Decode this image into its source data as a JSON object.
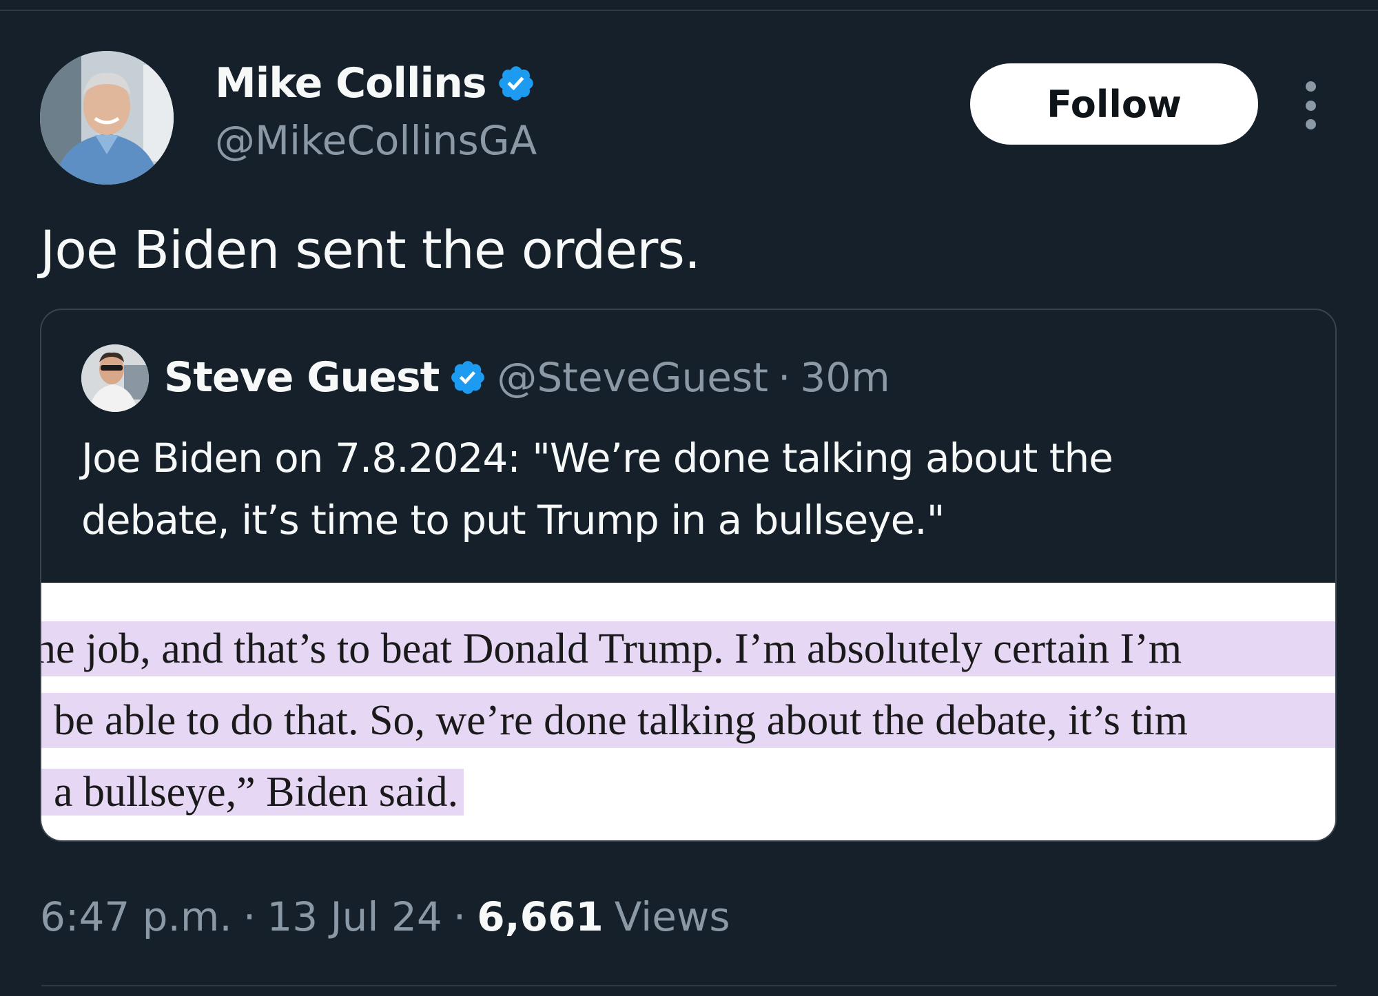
{
  "tweet": {
    "author": {
      "name": "Mike Collins",
      "handle": "@MikeCollinsGA"
    },
    "follow_label": "Follow",
    "text": "Joe Biden sent the orders.",
    "quoted": {
      "name": "Steve Guest",
      "handle": "@SteveGuest",
      "separator": "·",
      "time": "30m",
      "text_line1": "Joe Biden on 7.8.2024: \"We’re done talking about the",
      "text_line2": "debate, it’s time to put Trump in a bullseye.\"",
      "media": {
        "line1": "ne job, and that’s to beat Donald Trump. I’m absolutely certain I’m",
        "line2": "be able to do that. So, we’re done talking about the debate, it’s tim",
        "line3": "a bullseye,” Biden said."
      }
    },
    "meta": {
      "time": "6:47 p.m.",
      "sep1": "·",
      "date": "13 Jul 24",
      "sep2": "·",
      "views_count": "6,661",
      "views_label": "Views"
    }
  },
  "colors": {
    "background": "#15202b",
    "verified_blue": "#1d9bf0",
    "muted_text": "#8b98a5",
    "highlight": "#e6d8f5"
  },
  "icons": {
    "verified": "verified-badge-icon",
    "more": "more-options-icon"
  }
}
